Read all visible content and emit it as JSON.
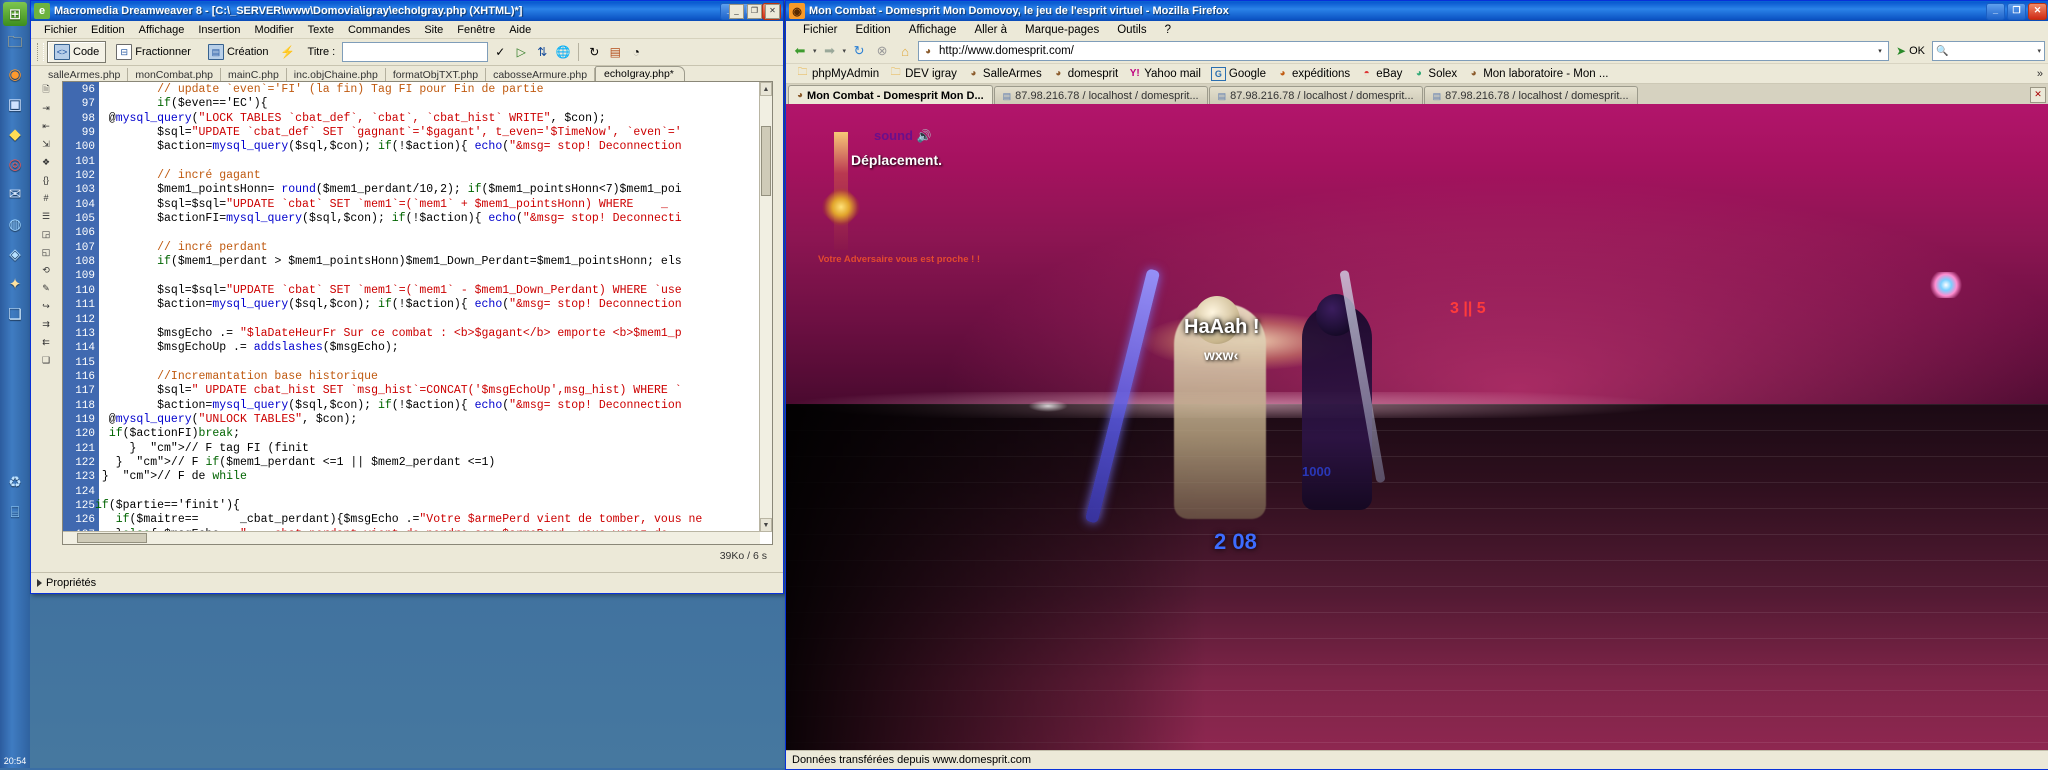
{
  "desktop": {
    "clock": "20:54",
    "quick_icons": [
      "windows-start-icon",
      "folder-icon",
      "firefox-icon",
      "media-icon",
      "shield-icon",
      "ie-icon",
      "mail-icon",
      "globe-icon",
      "msn-icon",
      "tools-icon",
      "chat-icon",
      "recycle-icon"
    ]
  },
  "dreamweaver": {
    "title": "Macromedia Dreamweaver 8 - [C:\\_SERVER\\www\\Domovia\\igray\\echoIgray.php (XHTML)*]",
    "titlebar_buttons": [
      "_",
      "❐",
      "✕"
    ],
    "menu": [
      "Fichier",
      "Edition",
      "Affichage",
      "Insertion",
      "Modifier",
      "Texte",
      "Commandes",
      "Site",
      "Fenêtre",
      "Aide"
    ],
    "toolbar": {
      "code_label": "Code",
      "split_label": "Fractionner",
      "design_label": "Création",
      "titre_label": "Titre :",
      "titre_value": "",
      "titre_placeholder": ""
    },
    "mdi_buttons": [
      "_",
      "❐",
      "✕"
    ],
    "tabs": [
      {
        "label": "salleArmes.php",
        "active": false
      },
      {
        "label": "monCombat.php",
        "active": false
      },
      {
        "label": "mainC.php",
        "active": false
      },
      {
        "label": "inc.objChaine.php",
        "active": false
      },
      {
        "label": "formatObjTXT.php",
        "active": false
      },
      {
        "label": "cabosseArmure.php",
        "active": false
      },
      {
        "label": "echoIgray.php*",
        "active": true
      }
    ],
    "status": "39Ko / 6 s",
    "properties_label": "Propriétés",
    "first_line_number": 96,
    "code_lines": [
      "         // update `even`='FI' (la fin) Tag FI pour Fin de partie",
      "         if($even=='EC'){",
      "  @mysql_query(\"LOCK TABLES `cbat_def`, `cbat`, `cbat_hist` WRITE\", $con);",
      "         $sql=\"UPDATE `cbat_def` SET `gagnant`='$gagant', t_even='$TimeNow', `even`='",
      "         $action=mysql_query($sql,$con); if(!$action){ echo(\"&msg= stop! Deconnection",
      "",
      "         // incré gagant",
      "         $mem1_pointsHonn= round($mem1_perdant/10,2); if($mem1_pointsHonn<7)$mem1_poi",
      "         $sql=$sql=\"UPDATE `cbat` SET `mem1`=(`mem1` + $mem1_pointsHonn) WHERE    _",
      "         $actionFI=mysql_query($sql,$con); if(!$action){ echo(\"&msg= stop! Deconnecti",
      "",
      "         // incré perdant",
      "         if($mem1_perdant > $mem1_pointsHonn)$mem1_Down_Perdant=$mem1_pointsHonn; els",
      "",
      "         $sql=$sql=\"UPDATE `cbat` SET `mem1`=(`mem1` - $mem1_Down_Perdant) WHERE `use",
      "         $action=mysql_query($sql,$con); if(!$action){ echo(\"&msg= stop! Deconnection",
      "",
      "         $msgEcho .= \"$laDateHeurFr Sur ce combat : <b>$gagant</b> emporte <b>$mem1_p",
      "         $msgEchoUp .= addslashes($msgEcho);",
      "",
      "         //Incremantation base historique",
      "         $sql=\" UPDATE cbat_hist SET `msg_hist`=CONCAT('$msgEchoUp',msg_hist) WHERE `",
      "         $action=mysql_query($sql,$con); if(!$action){ echo(\"&msg= stop! Deconnection",
      "  @mysql_query(\"UNLOCK TABLES\", $con);",
      "  if($actionFI)break;",
      "     }  // F tag FI (finit",
      "   }  // F if($mem1_perdant <=1 || $mem2_perdant <=1)",
      " }  // F de while",
      "",
      "if($partie=='finit'){",
      "   if($maitre==      _cbat_perdant){$msgEcho .=\"Votre $armePerd vient de tomber, vous ne",
      "   }else{ $msgEcho .=\"    cbat_perdant vient de perdre son $armePerd, vous venez de"
    ]
  },
  "firefox": {
    "title": "Mon Combat - Domesprit Mon Domovoy, le jeu de l'esprit virtuel - Mozilla Firefox",
    "titlebar_buttons": [
      "_",
      "❐",
      "✕"
    ],
    "menu": [
      "Fichier",
      "Edition",
      "Affichage",
      "Aller à",
      "Marque-pages",
      "Outils",
      "?"
    ],
    "nav_icons": [
      "back-icon",
      "forward-icon",
      "reload-icon",
      "stop-icon",
      "home-icon"
    ],
    "url": "http://www.domesprit.com/",
    "go_label": "OK",
    "search_placeholder": "",
    "bookmarks": [
      {
        "label": "phpMyAdmin",
        "icon": "folder-icon"
      },
      {
        "label": "DEV igray",
        "icon": "folder-icon"
      },
      {
        "label": "SalleArmes",
        "icon": "site-icon"
      },
      {
        "label": "domesprit",
        "icon": "site-icon"
      },
      {
        "label": "Yahoo mail",
        "icon": "yahoo-icon"
      },
      {
        "label": "Google",
        "icon": "google-icon"
      },
      {
        "label": "expéditions",
        "icon": "site-icon"
      },
      {
        "label": "eBay",
        "icon": "ebay-icon"
      },
      {
        "label": "Solex",
        "icon": "site-icon"
      },
      {
        "label": "Mon laboratoire - Mon ...",
        "icon": "site-icon"
      }
    ],
    "tabs": [
      {
        "label": "Mon Combat - Domesprit Mon D...",
        "active": true,
        "icon": "site-icon"
      },
      {
        "label": "87.98.216.78 / localhost / domesprit...",
        "active": false,
        "icon": "phpmyadmin-icon"
      },
      {
        "label": "87.98.216.78 / localhost / domesprit...",
        "active": false,
        "icon": "phpmyadmin-icon"
      },
      {
        "label": "87.98.216.78 / localhost / domesprit...",
        "active": false,
        "icon": "phpmyadmin-icon"
      }
    ],
    "statusbar": "Données transférées depuis www.domesprit.com"
  },
  "game": {
    "sound_label": "sound",
    "sound_icon": "speaker-icon",
    "message_deplacement": "Déplacement.",
    "message_warning": "Votre Adversaire vous est proche ! !",
    "shout": "HaAah !",
    "shout_sub": "wxw‹",
    "score": "3 || 5",
    "hp_blue": "2 08",
    "hp_dark": "1000",
    "colors": {
      "sky": "#a5125f",
      "ground": "#7e2448",
      "score_red": "#ff3b3b",
      "hp_blue": "#3d6cff",
      "sound_purple": "#6a0f8c"
    }
  }
}
